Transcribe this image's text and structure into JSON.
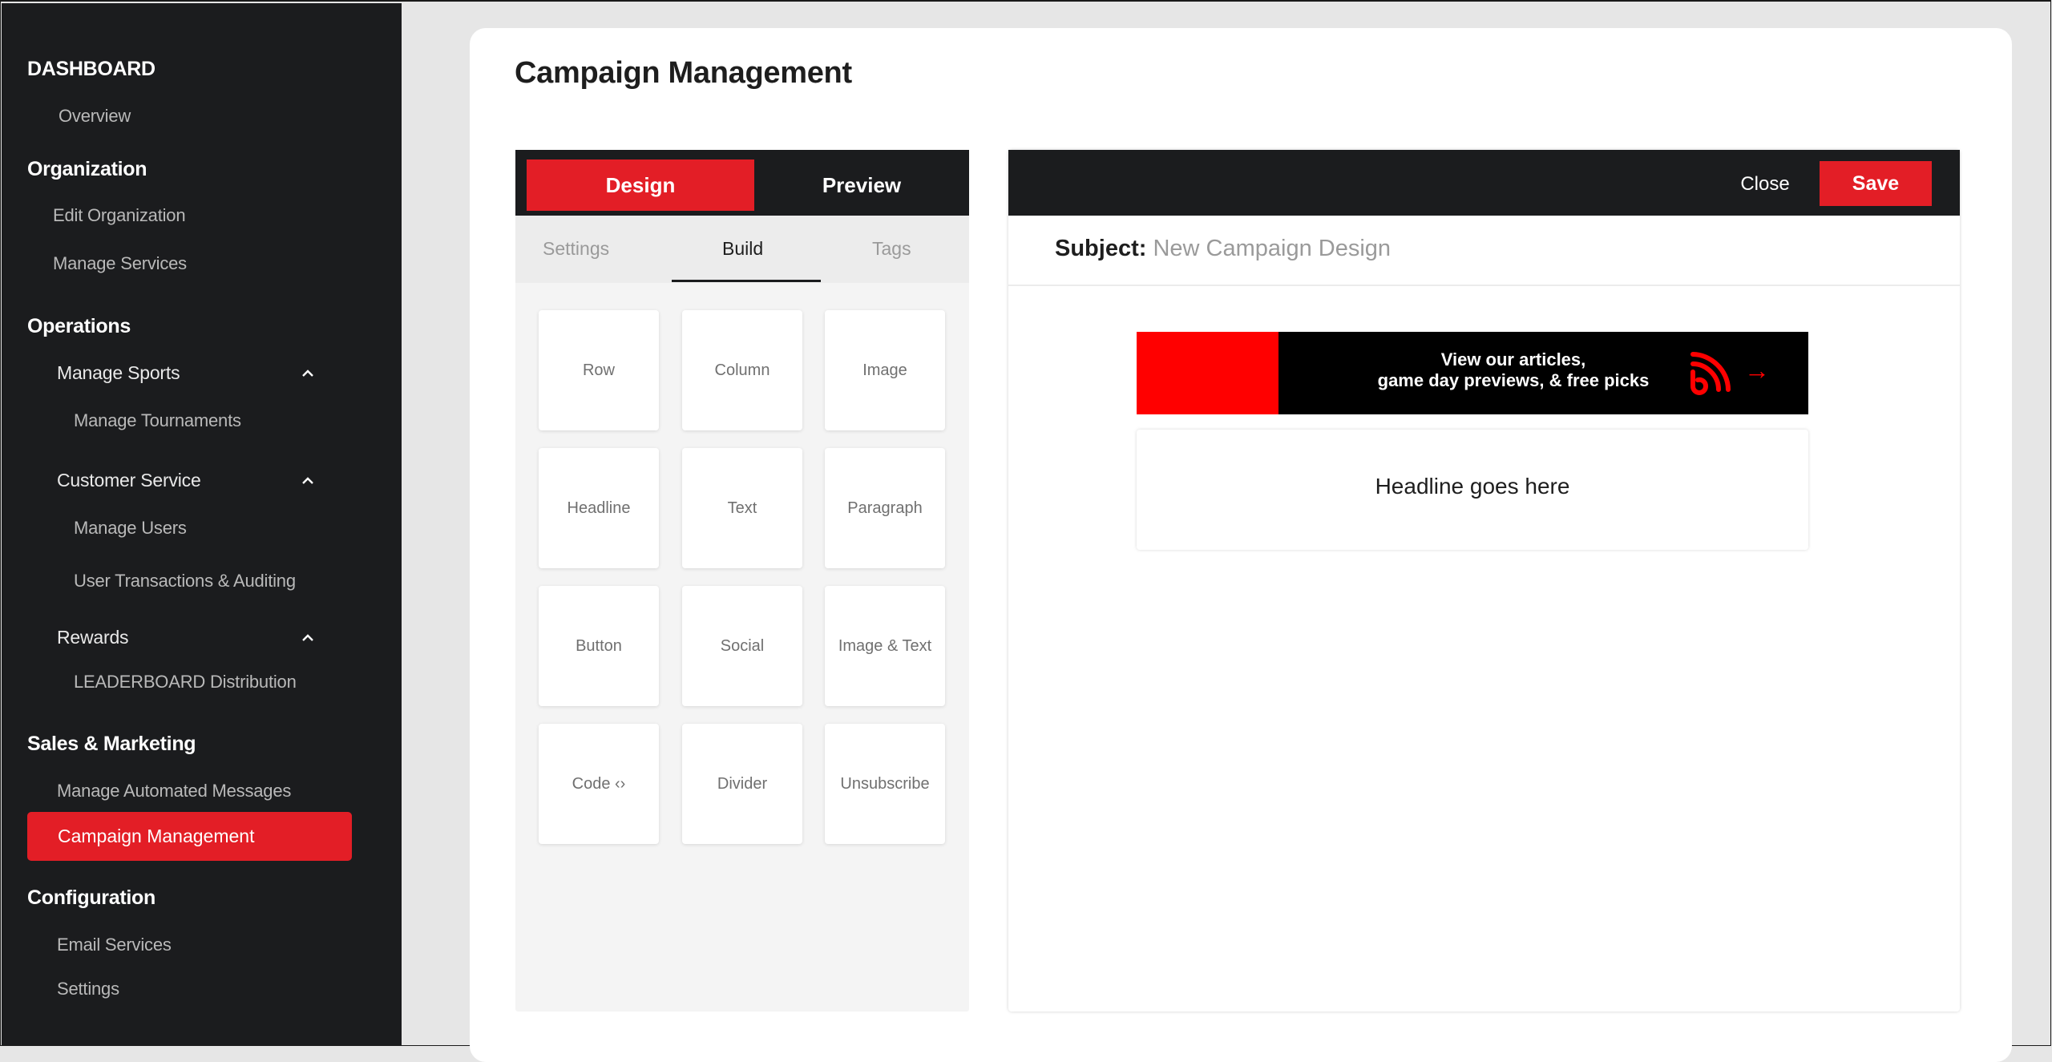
{
  "sidebar": {
    "dashboard": "DASHBOARD",
    "overview": "Overview",
    "organization": "Organization",
    "edit_org": "Edit Organization",
    "manage_services": "Manage Services",
    "operations": "Operations",
    "manage_sports": "Manage Sports",
    "manage_tournaments": "Manage Tournaments",
    "customer_service": "Customer Service",
    "manage_users": "Manage Users",
    "user_transactions": "User Transactions & Auditing",
    "rewards": "Rewards",
    "leaderboard": "LEADERBOARD Distribution",
    "sales_marketing": "Sales & Marketing",
    "automated_messages": "Manage Automated Messages",
    "campaign_management": "Campaign Management",
    "configuration": "Configuration",
    "email_services": "Email Services",
    "settings": "Settings"
  },
  "page": {
    "title": "Campaign Management"
  },
  "builder": {
    "design": "Design",
    "preview": "Preview",
    "tabs": {
      "settings": "Settings",
      "build": "Build",
      "tags": "Tags"
    },
    "tiles": [
      "Row",
      "Column",
      "Image",
      "Headline",
      "Text",
      "Paragraph",
      "Button",
      "Social",
      "Image & Text",
      "Code ‹›",
      "Divider",
      "Unsubscribe"
    ]
  },
  "preview": {
    "close": "Close",
    "save": "Save",
    "subject_label": "Subject:",
    "subject_value": "New Campaign Design",
    "banner_line1": "View our articles,",
    "banner_line2": "game day previews, & free picks",
    "banner_arrow": "→",
    "headline": "Headline goes here"
  },
  "colors": {
    "accent": "#e31e26",
    "sidebar": "#1b1c1e"
  }
}
